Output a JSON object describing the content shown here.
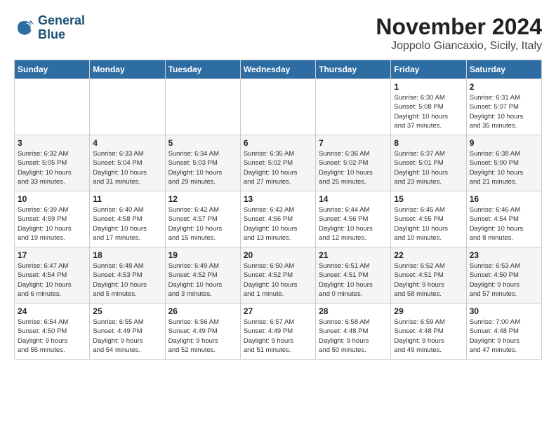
{
  "header": {
    "logo_line1": "General",
    "logo_line2": "Blue",
    "month": "November 2024",
    "location": "Joppolo Giancaxio, Sicily, Italy"
  },
  "weekdays": [
    "Sunday",
    "Monday",
    "Tuesday",
    "Wednesday",
    "Thursday",
    "Friday",
    "Saturday"
  ],
  "weeks": [
    [
      {
        "day": "",
        "info": ""
      },
      {
        "day": "",
        "info": ""
      },
      {
        "day": "",
        "info": ""
      },
      {
        "day": "",
        "info": ""
      },
      {
        "day": "",
        "info": ""
      },
      {
        "day": "1",
        "info": "Sunrise: 6:30 AM\nSunset: 5:08 PM\nDaylight: 10 hours\nand 37 minutes."
      },
      {
        "day": "2",
        "info": "Sunrise: 6:31 AM\nSunset: 5:07 PM\nDaylight: 10 hours\nand 35 minutes."
      }
    ],
    [
      {
        "day": "3",
        "info": "Sunrise: 6:32 AM\nSunset: 5:05 PM\nDaylight: 10 hours\nand 33 minutes."
      },
      {
        "day": "4",
        "info": "Sunrise: 6:33 AM\nSunset: 5:04 PM\nDaylight: 10 hours\nand 31 minutes."
      },
      {
        "day": "5",
        "info": "Sunrise: 6:34 AM\nSunset: 5:03 PM\nDaylight: 10 hours\nand 29 minutes."
      },
      {
        "day": "6",
        "info": "Sunrise: 6:35 AM\nSunset: 5:02 PM\nDaylight: 10 hours\nand 27 minutes."
      },
      {
        "day": "7",
        "info": "Sunrise: 6:36 AM\nSunset: 5:02 PM\nDaylight: 10 hours\nand 25 minutes."
      },
      {
        "day": "8",
        "info": "Sunrise: 6:37 AM\nSunset: 5:01 PM\nDaylight: 10 hours\nand 23 minutes."
      },
      {
        "day": "9",
        "info": "Sunrise: 6:38 AM\nSunset: 5:00 PM\nDaylight: 10 hours\nand 21 minutes."
      }
    ],
    [
      {
        "day": "10",
        "info": "Sunrise: 6:39 AM\nSunset: 4:59 PM\nDaylight: 10 hours\nand 19 minutes."
      },
      {
        "day": "11",
        "info": "Sunrise: 6:40 AM\nSunset: 4:58 PM\nDaylight: 10 hours\nand 17 minutes."
      },
      {
        "day": "12",
        "info": "Sunrise: 6:42 AM\nSunset: 4:57 PM\nDaylight: 10 hours\nand 15 minutes."
      },
      {
        "day": "13",
        "info": "Sunrise: 6:43 AM\nSunset: 4:56 PM\nDaylight: 10 hours\nand 13 minutes."
      },
      {
        "day": "14",
        "info": "Sunrise: 6:44 AM\nSunset: 4:56 PM\nDaylight: 10 hours\nand 12 minutes."
      },
      {
        "day": "15",
        "info": "Sunrise: 6:45 AM\nSunset: 4:55 PM\nDaylight: 10 hours\nand 10 minutes."
      },
      {
        "day": "16",
        "info": "Sunrise: 6:46 AM\nSunset: 4:54 PM\nDaylight: 10 hours\nand 8 minutes."
      }
    ],
    [
      {
        "day": "17",
        "info": "Sunrise: 6:47 AM\nSunset: 4:54 PM\nDaylight: 10 hours\nand 6 minutes."
      },
      {
        "day": "18",
        "info": "Sunrise: 6:48 AM\nSunset: 4:53 PM\nDaylight: 10 hours\nand 5 minutes."
      },
      {
        "day": "19",
        "info": "Sunrise: 6:49 AM\nSunset: 4:52 PM\nDaylight: 10 hours\nand 3 minutes."
      },
      {
        "day": "20",
        "info": "Sunrise: 6:50 AM\nSunset: 4:52 PM\nDaylight: 10 hours\nand 1 minute."
      },
      {
        "day": "21",
        "info": "Sunrise: 6:51 AM\nSunset: 4:51 PM\nDaylight: 10 hours\nand 0 minutes."
      },
      {
        "day": "22",
        "info": "Sunrise: 6:52 AM\nSunset: 4:51 PM\nDaylight: 9 hours\nand 58 minutes."
      },
      {
        "day": "23",
        "info": "Sunrise: 6:53 AM\nSunset: 4:50 PM\nDaylight: 9 hours\nand 57 minutes."
      }
    ],
    [
      {
        "day": "24",
        "info": "Sunrise: 6:54 AM\nSunset: 4:50 PM\nDaylight: 9 hours\nand 55 minutes."
      },
      {
        "day": "25",
        "info": "Sunrise: 6:55 AM\nSunset: 4:49 PM\nDaylight: 9 hours\nand 54 minutes."
      },
      {
        "day": "26",
        "info": "Sunrise: 6:56 AM\nSunset: 4:49 PM\nDaylight: 9 hours\nand 52 minutes."
      },
      {
        "day": "27",
        "info": "Sunrise: 6:57 AM\nSunset: 4:49 PM\nDaylight: 9 hours\nand 51 minutes."
      },
      {
        "day": "28",
        "info": "Sunrise: 6:58 AM\nSunset: 4:48 PM\nDaylight: 9 hours\nand 50 minutes."
      },
      {
        "day": "29",
        "info": "Sunrise: 6:59 AM\nSunset: 4:48 PM\nDaylight: 9 hours\nand 49 minutes."
      },
      {
        "day": "30",
        "info": "Sunrise: 7:00 AM\nSunset: 4:48 PM\nDaylight: 9 hours\nand 47 minutes."
      }
    ]
  ]
}
